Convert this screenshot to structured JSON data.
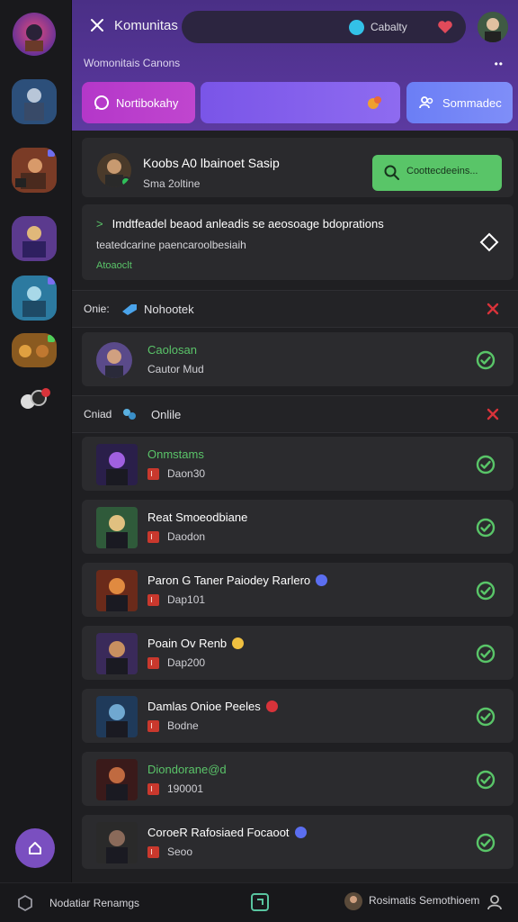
{
  "header": {
    "title": "Komunitas",
    "search_label": "Cabalty",
    "subtitle": "Womonitais Canons",
    "more": "••"
  },
  "tabs": [
    {
      "label": "Nortibokahy"
    },
    {
      "label": ""
    },
    {
      "label": "Sommadec"
    }
  ],
  "profile": {
    "name": "Koobs A0 lbainoet Sasip",
    "status": "Sma 2oltine",
    "find_button": "Coottecdeeins..."
  },
  "notice": {
    "line1": "Imdtfeadel beaod  anleadis se aeosoage bdoprations",
    "line2": "teatedcarine paencaroolbesiaih",
    "link": "Atoaoclt"
  },
  "sections": [
    {
      "label": "Onie:",
      "name": "Nohootek"
    },
    {
      "label": "Cniad",
      "name": "Onlile"
    }
  ],
  "friend": {
    "title": "Caolosan",
    "sub": "Cautor Mud"
  },
  "rows": [
    {
      "title": "Onmstams",
      "sub": "Daon30",
      "green": true
    },
    {
      "title": "Reat Smoeodbiane",
      "sub": "Daodon"
    },
    {
      "title": "Paron G Taner Paiodey Rarlero",
      "sub": "Dap101"
    },
    {
      "title": "Poain Ov Renb",
      "sub": "Dap200"
    },
    {
      "title": "Damlas Onioe Peeles",
      "sub": "Bodne"
    },
    {
      "title": "Diondorane@d",
      "sub": "190001",
      "green": true
    },
    {
      "title": "CoroeR Rafosiaed Focaoot",
      "sub": "Seoo"
    }
  ],
  "bottom": {
    "left": "Nodatiar Renamgs",
    "right": "Rosimatis Semothioem"
  },
  "colors": {
    "accent_green": "#59c568",
    "header_purple": "#553596",
    "tab_magenta": "#b437c9",
    "tab_violet": "#7a55e8",
    "tab_blue": "#6b7ef5",
    "close_red": "#d8333a"
  }
}
